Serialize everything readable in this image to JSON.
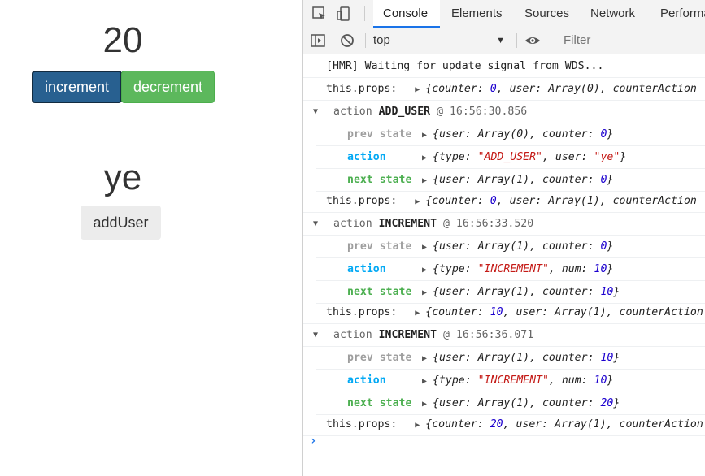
{
  "app": {
    "counter": "20",
    "increment_label": "increment",
    "decrement_label": "decrement",
    "user": "ye",
    "add_user_label": "addUser"
  },
  "devtools": {
    "tabs": [
      "Console",
      "Elements",
      "Sources",
      "Network",
      "Performa"
    ],
    "active_tab": "Console",
    "context": "top",
    "filter_placeholder": "Filter",
    "icons": [
      "inspect-icon",
      "device-toolbar-icon",
      "sidebar-toggle-icon",
      "clear-console-icon",
      "eye-icon"
    ]
  },
  "console": {
    "hmr": "[HMR] Waiting for update signal from WDS...",
    "props_prefix": "this.props:",
    "props": [
      {
        "counter": "0",
        "user": "Array(0)"
      },
      {
        "counter": "0",
        "user": "Array(1)"
      },
      {
        "counter": "10",
        "user": "Array(1)"
      },
      {
        "counter": "20",
        "user": "Array(1)"
      }
    ],
    "props_tail": "counterAction",
    "groups": [
      {
        "head_prefix": "action",
        "name": "ADD_USER",
        "time": "@ 16:56:30.856",
        "prev_label": "prev state",
        "prev_user": "Array(0)",
        "prev_counter": "0",
        "action_label": "action",
        "action_type": "\"ADD_USER\"",
        "action_key": "user",
        "action_value": "\"ye\"",
        "next_label": "next state",
        "next_user": "Array(1)",
        "next_counter": "0"
      },
      {
        "head_prefix": "action",
        "name": "INCREMENT",
        "time": "@ 16:56:33.520",
        "prev_label": "prev state",
        "prev_user": "Array(1)",
        "prev_counter": "0",
        "action_label": "action",
        "action_type": "\"INCREMENT\"",
        "action_key": "num",
        "action_value": "10",
        "next_label": "next state",
        "next_user": "Array(1)",
        "next_counter": "10"
      },
      {
        "head_prefix": "action",
        "name": "INCREMENT",
        "time": "@ 16:56:36.071",
        "prev_label": "prev state",
        "prev_user": "Array(1)",
        "prev_counter": "10",
        "action_label": "action",
        "action_type": "\"INCREMENT\"",
        "action_key": "num",
        "action_value": "10",
        "next_label": "next state",
        "next_user": "Array(1)",
        "next_counter": "20"
      }
    ],
    "prompt": "›"
  },
  "colors": {
    "prev_state": "#9e9e9e",
    "action": "#03a9f4",
    "next_state": "#4caf50",
    "increment_bg": "#286090",
    "decrement_bg": "#5cb85c",
    "tab_accent": "#1a73e8"
  }
}
